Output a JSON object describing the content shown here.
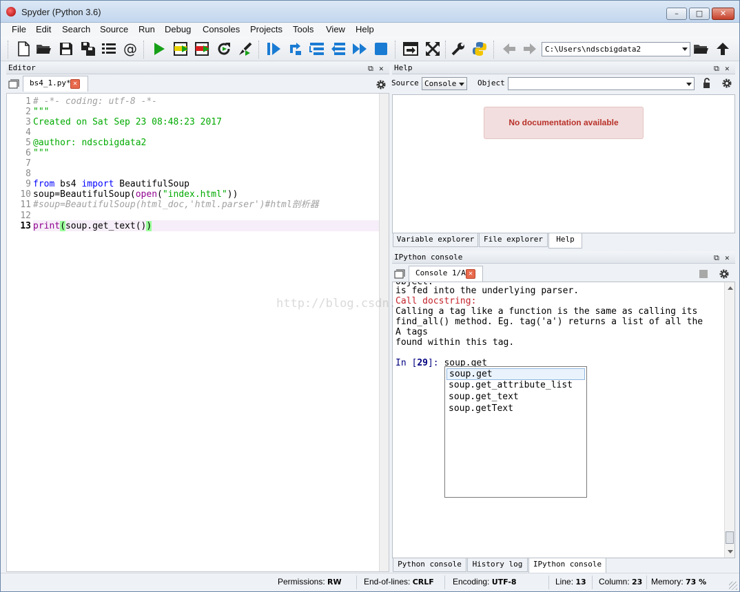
{
  "window": {
    "title": "Spyder (Python 3.6)"
  },
  "menubar": [
    "File",
    "Edit",
    "Search",
    "Source",
    "Run",
    "Debug",
    "Consoles",
    "Projects",
    "Tools",
    "View",
    "Help"
  ],
  "toolbar": {
    "icons": [
      "new-file-icon",
      "open-file-icon",
      "save-icon",
      "save-all-icon",
      "list-icon",
      "at-icon",
      "run-icon",
      "run-cell-icon",
      "run-cell-advance-icon",
      "rerun-icon",
      "run-selection-icon",
      "debug-icon",
      "step-icon",
      "step-into-icon",
      "step-return-icon",
      "continue-icon",
      "stop-icon",
      "maximize-pane-icon",
      "fullscreen-icon",
      "preferences-icon",
      "python-path-icon",
      "back-icon",
      "forward-icon",
      "browse-folder-icon",
      "parent-dir-icon"
    ],
    "working_dir": "C:\\Users\\ndscbigdata2"
  },
  "editor": {
    "pane_title": "Editor",
    "tab_label": "bs4_1.py*",
    "lines": [
      {
        "n": "1",
        "text": "# -*- coding: utf-8 -*-"
      },
      {
        "n": "2",
        "text": "\"\"\""
      },
      {
        "n": "3",
        "text": "Created on Sat Sep 23 08:48:23 2017"
      },
      {
        "n": "4",
        "text": ""
      },
      {
        "n": "5",
        "text": "@author: ndscbigdata2"
      },
      {
        "n": "6",
        "text": "\"\"\""
      },
      {
        "n": "7",
        "text": ""
      },
      {
        "n": "8",
        "text": ""
      },
      {
        "n": "9",
        "text": "from bs4 import BeautifulSoup"
      },
      {
        "n": "10",
        "text": "soup=BeautifulSoup(open(\"index.html\"))"
      },
      {
        "n": "11",
        "text": "#soup=BeautifulSoup(html_doc,'html.parser')#html剖析器"
      },
      {
        "n": "12",
        "text": ""
      },
      {
        "n": "13",
        "text": "print(soup.get_text())"
      }
    ],
    "tokens": {
      "l9_from": "from",
      "l9_mod": " bs4 ",
      "l9_import": "import",
      "l9_rest": " BeautifulSoup",
      "l10_a": "soup=BeautifulSoup(",
      "l10_open": "open",
      "l10_p": "(",
      "l10_str": "\"index.html\"",
      "l10_end": "))",
      "l13_print": "print",
      "l13_po": "(",
      "l13_mid": "soup.get_text()",
      "l13_pc": ")"
    }
  },
  "help": {
    "pane_title": "Help",
    "source_label": "Source",
    "source_value": "Console",
    "object_label": "Object",
    "object_value": "",
    "message": "No documentation available",
    "tabs": [
      "Variable explorer",
      "File explorer",
      "Help"
    ]
  },
  "console": {
    "pane_title": "IPython console",
    "tab_label": "Console 1/A",
    "lines": [
      "Object.",
      "is fed into the underlying parser.",
      "Call docstring:",
      "Calling a tag like a function is the same as calling its",
      "find_all() method. Eg. tag('a') returns a list of all the",
      "A tags",
      "found within this tag."
    ],
    "prompt_in": "In [",
    "prompt_num": "29",
    "prompt_close": "]: ",
    "input": "soup.get",
    "completions": [
      "soup.get",
      "soup.get_attribute_list",
      "soup.get_text",
      "soup.getText"
    ],
    "bottom_tabs": [
      "Python console",
      "History log",
      "IPython console"
    ]
  },
  "watermark": "http://blog.csdn.",
  "statusbar": {
    "permissions_label": "Permissions:",
    "permissions": "RW",
    "eol_label": "End-of-lines:",
    "eol": "CRLF",
    "encoding_label": "Encoding:",
    "encoding": "UTF-8",
    "line_label": "Line:",
    "line": "13",
    "column_label": "Column:",
    "column": "23",
    "memory_label": "Memory:",
    "memory": "73 %"
  }
}
